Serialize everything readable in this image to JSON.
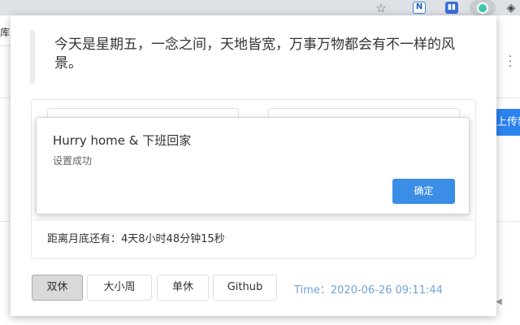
{
  "browser": {
    "page_left_text": "库",
    "upload_button_label": "上传新"
  },
  "popup": {
    "quote": "今天是星期五，一念之间，天地皆宽，万事万物都会有不一样的风景。",
    "countdown": "距离月底还有：4天8小时48分钟15秒",
    "modes": [
      "双休",
      "大小周",
      "单休",
      "Github"
    ],
    "active_mode": "双休",
    "time": "Time：2020-06-26 09:11:44"
  },
  "dialog": {
    "title": "Hurry home & 下班回家",
    "message": "设置成功",
    "confirm_label": "确定"
  },
  "colors": {
    "primary_button": "#3a8ee6",
    "time_text": "#6fa3d8",
    "active_mode_bg": "#d9d9d9"
  },
  "icons": [
    "star-icon",
    "n-extension-icon",
    "chart-extension-icon",
    "active-extension-icon",
    "fish-extension-icon",
    "menu-dots-icon"
  ]
}
